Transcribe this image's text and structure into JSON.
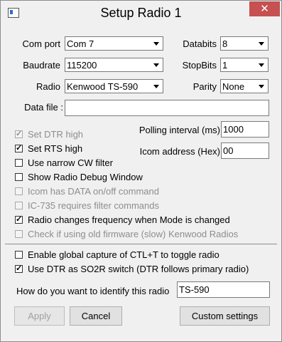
{
  "window": {
    "title": "Setup Radio 1",
    "close_glyph": "✕"
  },
  "labels": {
    "com_port": "Com port",
    "baudrate": "Baudrate",
    "radio": "Radio",
    "databits": "Databits",
    "stopbits": "StopBits",
    "parity": "Parity",
    "data_file": "Data file :",
    "polling_interval": "Polling interval (ms)",
    "icom_address": "Icom address (Hex)",
    "identify": "How do you want to identify this radio"
  },
  "fields": {
    "com_port": "Com 7",
    "baudrate": "115200",
    "radio": "Kenwood TS-590",
    "databits": "8",
    "stopbits": "1",
    "parity": "None",
    "data_file": "",
    "polling_interval": "1000",
    "icom_address": "00",
    "identify": "TS-590"
  },
  "checkboxes": [
    {
      "label": "Set DTR high",
      "checked": true,
      "enabled": false
    },
    {
      "label": "Set RTS high",
      "checked": true,
      "enabled": true
    },
    {
      "label": "Use narrow CW filter",
      "checked": false,
      "enabled": true
    },
    {
      "label": "Show Radio Debug Window",
      "checked": false,
      "enabled": true
    },
    {
      "label": "Icom has DATA on/off command",
      "checked": false,
      "enabled": false
    },
    {
      "label": "IC-735 requires filter commands",
      "checked": false,
      "enabled": false
    },
    {
      "label": "Radio changes frequency when Mode is changed",
      "checked": true,
      "enabled": true
    },
    {
      "label": "Check if using old firmware (slow) Kenwood Radios",
      "checked": false,
      "enabled": false
    },
    {
      "label": "Enable global capture of CTL+T to toggle radio",
      "checked": false,
      "enabled": true
    },
    {
      "label": "Use DTR as SO2R switch (DTR follows primary radio)",
      "checked": true,
      "enabled": true
    }
  ],
  "buttons": {
    "apply": "Apply",
    "cancel": "Cancel",
    "custom": "Custom settings"
  }
}
